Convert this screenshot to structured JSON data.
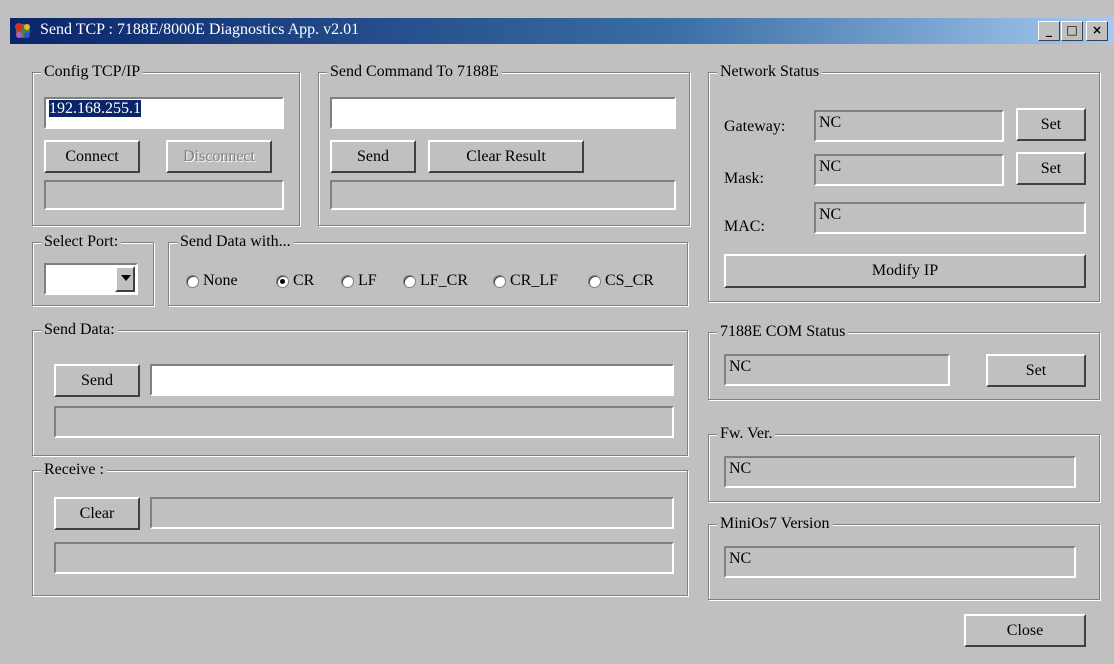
{
  "window": {
    "title": "Send TCP : 7188E/8000E Diagnostics App. v2.01",
    "minimize": "_",
    "maximize": "□",
    "close": "×"
  },
  "config": {
    "legend": "Config TCP/IP",
    "ip": "192.168.255.1",
    "connect": "Connect",
    "disconnect": "Disconnect",
    "status": ""
  },
  "command": {
    "legend": "Send Command To 7188E",
    "value": "",
    "send": "Send",
    "clear_result": "Clear Result",
    "result": ""
  },
  "port": {
    "legend": "Select Port:",
    "value": ""
  },
  "send_with": {
    "legend": "Send Data with...",
    "options": [
      {
        "label": "None",
        "checked": false
      },
      {
        "label": "CR",
        "checked": true
      },
      {
        "label": "LF",
        "checked": false
      },
      {
        "label": "LF_CR",
        "checked": false
      },
      {
        "label": "CR_LF",
        "checked": false
      },
      {
        "label": "CS_CR",
        "checked": false
      }
    ]
  },
  "send_data": {
    "legend": "Send Data:",
    "send": "Send",
    "value": "",
    "result": ""
  },
  "receive": {
    "legend": "Receive :",
    "clear": "Clear",
    "value": "",
    "result": ""
  },
  "network": {
    "legend": "Network Status",
    "gateway_label": "Gateway:",
    "gateway": "NC",
    "mask_label": "Mask:",
    "mask": "NC",
    "mac_label": "MAC:",
    "mac": "NC",
    "set": "Set",
    "modify_ip": "Modify IP"
  },
  "com_status": {
    "legend": "7188E COM Status",
    "value": "NC",
    "set": "Set"
  },
  "fw": {
    "legend": "Fw. Ver.",
    "value": "NC"
  },
  "minios": {
    "legend": "MiniOs7 Version",
    "value": "NC"
  },
  "close_button": "Close"
}
